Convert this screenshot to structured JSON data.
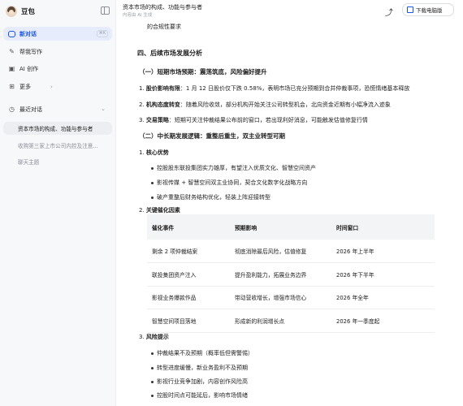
{
  "app": {
    "name": "豆包"
  },
  "sidebar": {
    "new_chat": {
      "label": "新对话",
      "shortcut": "⌘K"
    },
    "items": [
      {
        "label": "帮我写作"
      },
      {
        "label": "AI 创作"
      },
      {
        "label": "更多"
      }
    ],
    "recent_label": "最近对话",
    "history": [
      "资本市场的构成、功能与参与者",
      "收购第三家上市公司内控及注意...",
      "聊天主题"
    ]
  },
  "topbar": {
    "title": "资本市场的构成、功能与参与者",
    "subtitle": "内容由 AI 生成",
    "download_label": "下载电脑版"
  },
  "content": {
    "top_line": "的合规性要求",
    "section4": "四、后续市场发展分析",
    "sub1": "（一）短期市场预期：震荡筑底，风险偏好提升",
    "sub1_items": [
      {
        "num": "1.",
        "lead": "股价影响有限",
        "text": "：1 月 12 日股价仅下跌 0.58%，表明市场已充分预期到合并仲裁事项，恐慌情绪基本释放"
      },
      {
        "num": "2.",
        "lead": "机构态度转变",
        "text": "：随着风险收敛，部分机构开始关注公司转型机会，北向资金近期有小幅净流入迹象"
      },
      {
        "num": "3.",
        "lead": "交易策略",
        "text": "：短期可关注仲裁结果公布前的窗口，若出现利好消息，可能触发估值修复行情"
      }
    ],
    "sub2": "（二）中长期发展逻辑：重整后重生，双主业转型可期",
    "core_num": "1.",
    "core_title": "核心优势",
    "core_points": [
      "控股股东联投集团实力雄厚，有望注入优质文化、智慧空间资产",
      "影视传媒 + 智慧空间双主业协同，契合文化数字化战略方向",
      "破产重整后财务结构优化，轻装上阵迎接转型"
    ],
    "catalyst_num": "2.",
    "catalyst_title": "关键催化因素",
    "table": {
      "headers": [
        "催化事件",
        "预期影响",
        "时间窗口"
      ],
      "rows": [
        [
          "剩余 2 项仲裁结案",
          "彻底消除最后风险，估值修复",
          "2026 年上半年"
        ],
        [
          "联投集团资产注入",
          "提升盈利能力，拓展业务边界",
          "2026 年下半年"
        ],
        [
          "影视业务爆款作品",
          "带动营收增长，增强市场信心",
          "2026 年全年"
        ],
        [
          "智慧空间项目落地",
          "形成新的利润增长点",
          "2026 年一季度起"
        ]
      ]
    },
    "risk_num": "3.",
    "risk_title": "风险提示",
    "risk_points": [
      "仲裁结果不及预期（概率低但需警惕）",
      "转型进度缓慢，新业务盈利不及预期",
      "影视行业竞争加剧，内容创作风险高",
      "控股时间点可能延后，影响市场情绪"
    ]
  }
}
